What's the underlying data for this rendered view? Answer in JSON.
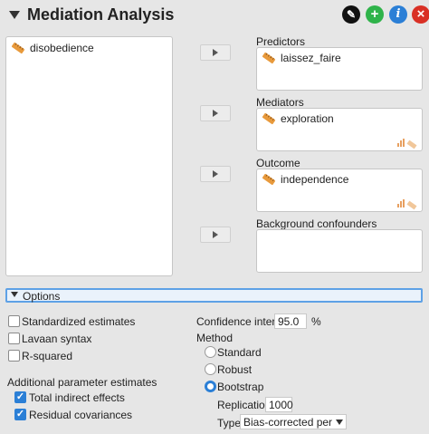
{
  "header": {
    "title": "Mediation Analysis"
  },
  "available_variables": [
    "disobedience"
  ],
  "targets": {
    "predictors": {
      "label": "Predictors",
      "items": [
        "laissez_faire"
      ]
    },
    "mediators": {
      "label": "Mediators",
      "items": [
        "exploration"
      ]
    },
    "outcome": {
      "label": "Outcome",
      "items": [
        "independence"
      ]
    },
    "background": {
      "label": "Background confounders",
      "items": []
    }
  },
  "options": {
    "section_label": "Options",
    "standardized": {
      "label": "Standardized estimates",
      "checked": false
    },
    "lavaan": {
      "label": "Lavaan syntax",
      "checked": false
    },
    "rsquared": {
      "label": "R-squared",
      "checked": false
    },
    "additional_heading": "Additional parameter estimates",
    "total_indirect": {
      "label": "Total indirect effects",
      "checked": true
    },
    "residual_cov": {
      "label": "Residual covariances",
      "checked": true
    },
    "ci_label": "Confidence intervals",
    "ci_value": "95.0",
    "ci_unit": "%",
    "method_label": "Method",
    "method_standard": "Standard",
    "method_robust": "Robust",
    "method_bootstrap": "Bootstrap",
    "method_selected": "Bootstrap",
    "replications_label": "Replications",
    "replications_value": "1000",
    "type_label": "Type",
    "type_value": "Bias-corrected percentile"
  },
  "icons": {
    "header_buttons": [
      "edit-icon",
      "add-icon",
      "info-icon",
      "close-icon"
    ],
    "header_colors": {
      "edit": "#111111",
      "add": "#2fb34a",
      "info": "#2b7fd6",
      "close": "#d93025"
    },
    "accent": "#2b7fd6",
    "variable_type": "continuous-ruler-icon"
  }
}
